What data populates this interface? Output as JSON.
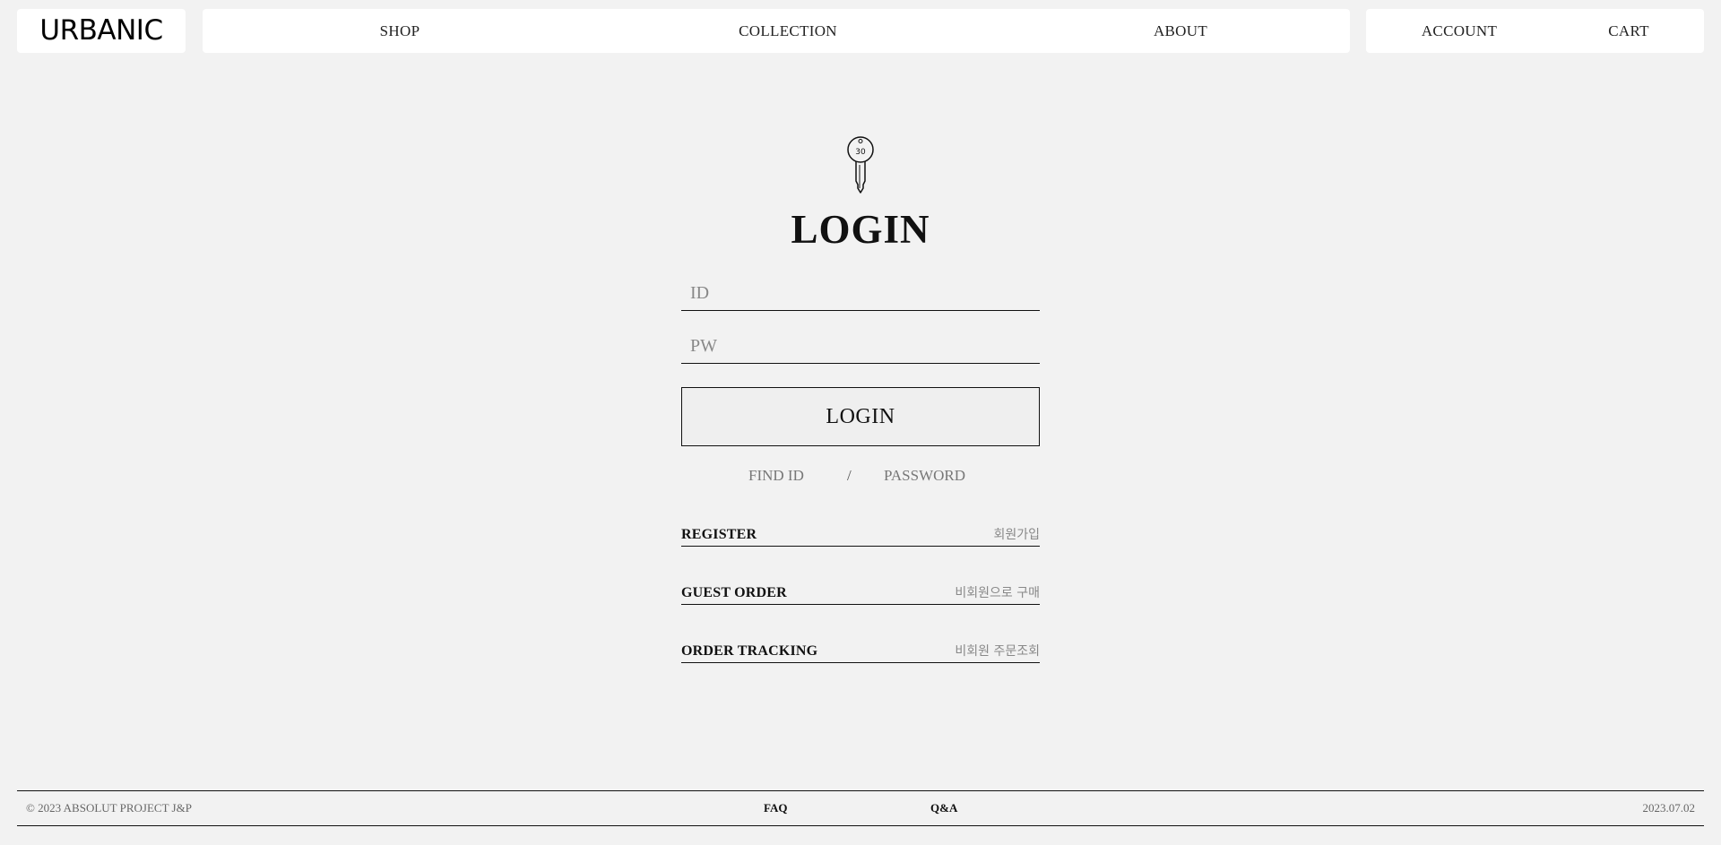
{
  "header": {
    "logo": "URBANIC",
    "main_nav": [
      "SHOP",
      "COLLECTION",
      "ABOUT"
    ],
    "user_nav": [
      "ACCOUNT",
      "CART"
    ]
  },
  "login": {
    "key_icon_badge": "30",
    "title": "LOGIN",
    "id_placeholder": "ID",
    "pw_placeholder": "PW",
    "button_label": "LOGIN",
    "find_id": "FIND ID",
    "separator": "/",
    "find_password": "PASSWORD"
  },
  "links": [
    {
      "label": "REGISTER",
      "sub": "회원가입"
    },
    {
      "label": "GUEST ORDER",
      "sub": "비회원으로 구매"
    },
    {
      "label": "ORDER TRACKING",
      "sub": "비회원 주문조회"
    }
  ],
  "footer": {
    "copyright": "© 2023 ABSOLUT PROJECT J&P",
    "faq": "FAQ",
    "qa": "Q&A",
    "date": "2023.07.02"
  },
  "colors": {
    "background": "#f2f2f2",
    "panel": "#ffffff",
    "text": "#111111",
    "muted": "#888888"
  }
}
